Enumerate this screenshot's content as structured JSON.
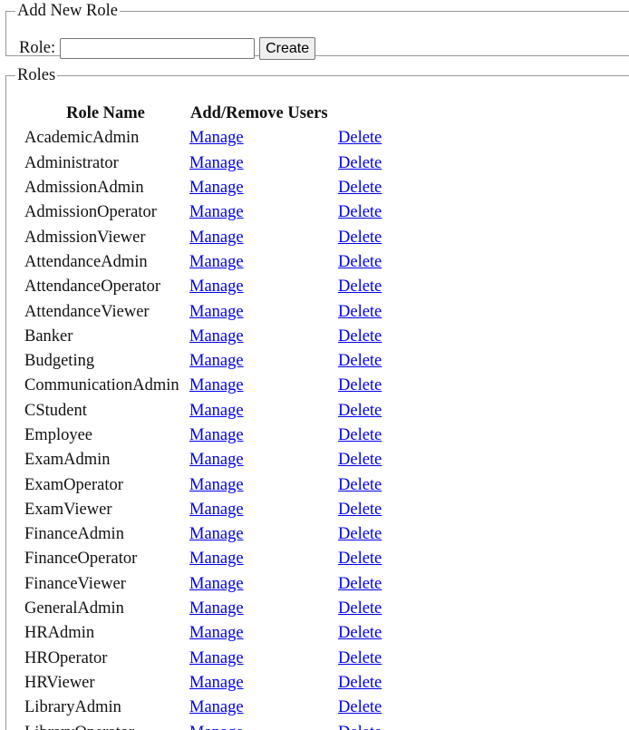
{
  "add_role": {
    "legend": "Add New Role",
    "role_label": "Role:",
    "role_value": "",
    "create_label": "Create"
  },
  "roles": {
    "legend": "Roles",
    "headers": {
      "name": "Role Name",
      "users": "Add/Remove Users"
    },
    "manage_label": "Manage",
    "delete_label": "Delete",
    "items": [
      "AcademicAdmin",
      "Administrator",
      "AdmissionAdmin",
      "AdmissionOperator",
      "AdmissionViewer",
      "AttendanceAdmin",
      "AttendanceOperator",
      "AttendanceViewer",
      "Banker",
      "Budgeting",
      "CommunicationAdmin",
      "CStudent",
      "Employee",
      "ExamAdmin",
      "ExamOperator",
      "ExamViewer",
      "FinanceAdmin",
      "FinanceOperator",
      "FinanceViewer",
      "GeneralAdmin",
      "HRAdmin",
      "HROperator",
      "HRViewer",
      "LibraryAdmin",
      "LibraryOperator"
    ]
  },
  "colors": {
    "link": "#0000ee",
    "border": "#9a9a9a",
    "button_bg": "#efefef"
  }
}
